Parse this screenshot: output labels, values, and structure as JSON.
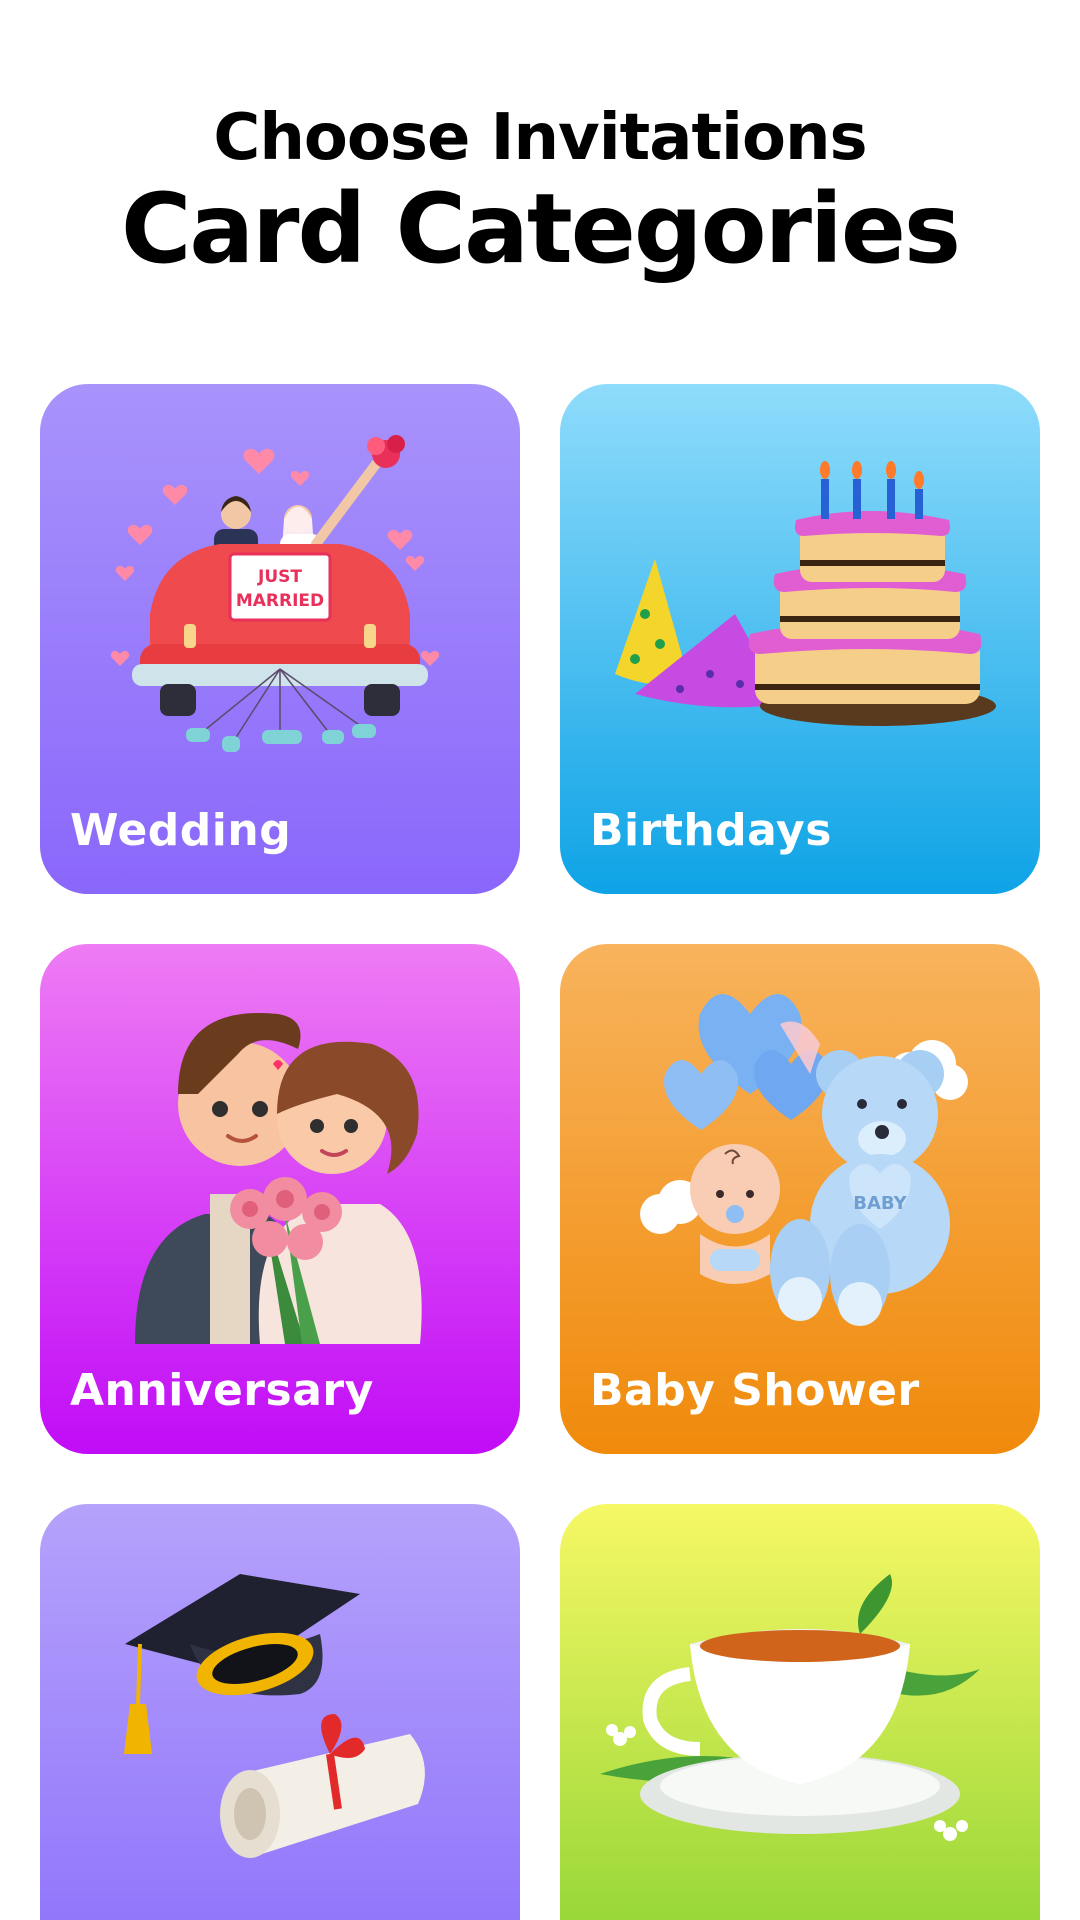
{
  "header": {
    "subtitle": "Choose Invitations",
    "title": "Card Categories"
  },
  "categories": [
    {
      "label": "Wedding",
      "icon": "wedding-car-icon",
      "colors": [
        "#a893fb",
        "#8a67fb"
      ]
    },
    {
      "label": "Birthdays",
      "icon": "birthday-cake-icon",
      "colors": [
        "#8fdcfb",
        "#0ea3e6"
      ]
    },
    {
      "label": "Anniversary",
      "icon": "couple-icon",
      "colors": [
        "#ee7cf4",
        "#c10cf7"
      ]
    },
    {
      "label": "Baby Shower",
      "icon": "teddy-bear-baby-icon",
      "colors": [
        "#f8b35c",
        "#f08a0b"
      ]
    },
    {
      "label": "",
      "icon": "graduation-cap-icon",
      "colors": [
        "#b5a2fb",
        "#8f72fb"
      ]
    },
    {
      "label": "",
      "icon": "tea-cup-icon",
      "colors": [
        "#f6f865",
        "#8fd434"
      ]
    }
  ],
  "wedding_sign": [
    "JUST",
    "MARRIED"
  ],
  "baby_bear_text": "BABY"
}
